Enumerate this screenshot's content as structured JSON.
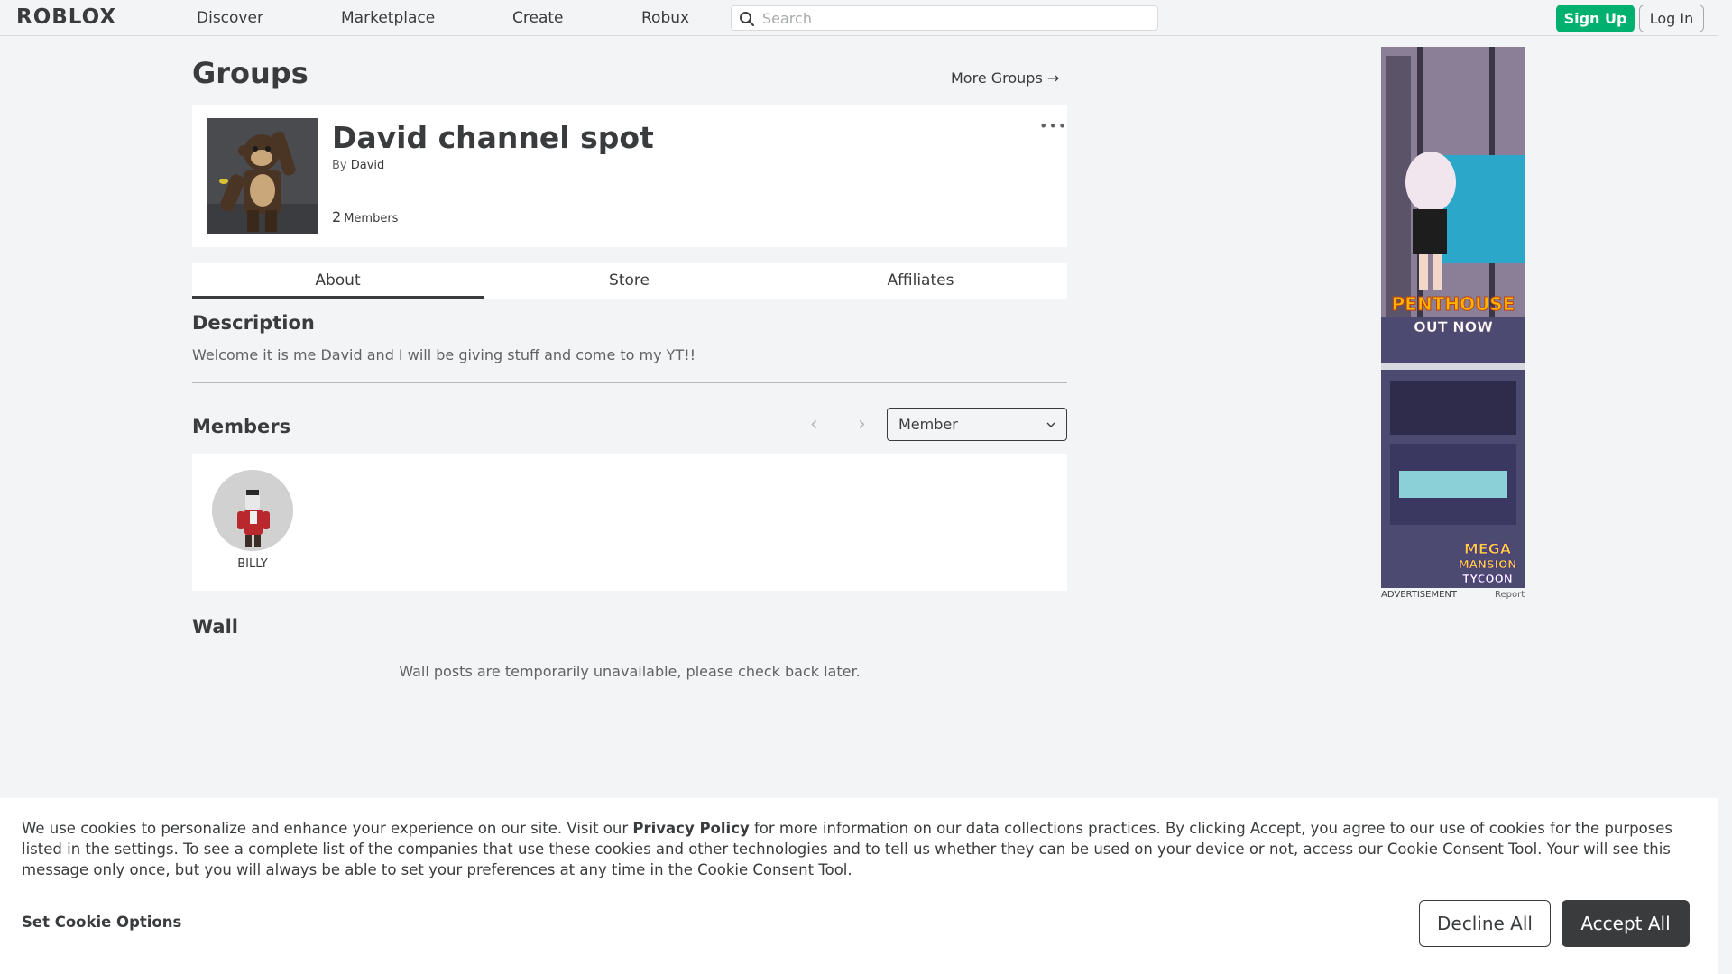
{
  "header": {
    "logo": "ROBLOX",
    "nav": [
      "Discover",
      "Marketplace",
      "Create",
      "Robux"
    ],
    "search_placeholder": "Search",
    "signup_label": "Sign Up",
    "login_label": "Log In"
  },
  "page": {
    "title": "Groups",
    "more_groups": "More Groups →"
  },
  "group": {
    "name": "David channel spot",
    "by_label": "By",
    "owner": "David",
    "member_count": "2",
    "member_count_label": "Members",
    "more_menu": "•••"
  },
  "tabs": [
    "About",
    "Store",
    "Affiliates"
  ],
  "description": {
    "heading": "Description",
    "text": "Welcome it is me David and I will be giving stuff and come to my YT!!"
  },
  "members": {
    "heading": "Members",
    "prev": "‹",
    "next": "›",
    "role_selected": "Member",
    "list": [
      {
        "name": "BILLY"
      }
    ]
  },
  "wall": {
    "heading": "Wall",
    "message": "Wall posts are temporarily unavailable, please check back later."
  },
  "ad": {
    "label": "ADVERTISEMENT",
    "report": "Report",
    "headline1": "PENTHOUSE",
    "headline2": "OUT NOW",
    "brand1": "MEGA",
    "brand2": "MANSION",
    "brand3": "TYCOON"
  },
  "cookie": {
    "text_before": "We use cookies to personalize and enhance your experience on our site. Visit our ",
    "privacy_link": "Privacy Policy",
    "text_after": " for more information on our data collections practices. By clicking Accept, you agree to our use of cookies for the purposes listed in the settings. To see a complete list of the companies that use these cookies and other technologies and to tell us whether they can be used on your device or not, access our Cookie Consent Tool. Your will see this message only once, but you will always be able to set your preferences at any time in the Cookie Consent Tool.",
    "set_options": "Set Cookie Options",
    "decline": "Decline All",
    "accept": "Accept All"
  },
  "colors": {
    "accent_green": "#00b06f",
    "text_dark": "#393b3d",
    "background": "#f2f4f5"
  }
}
